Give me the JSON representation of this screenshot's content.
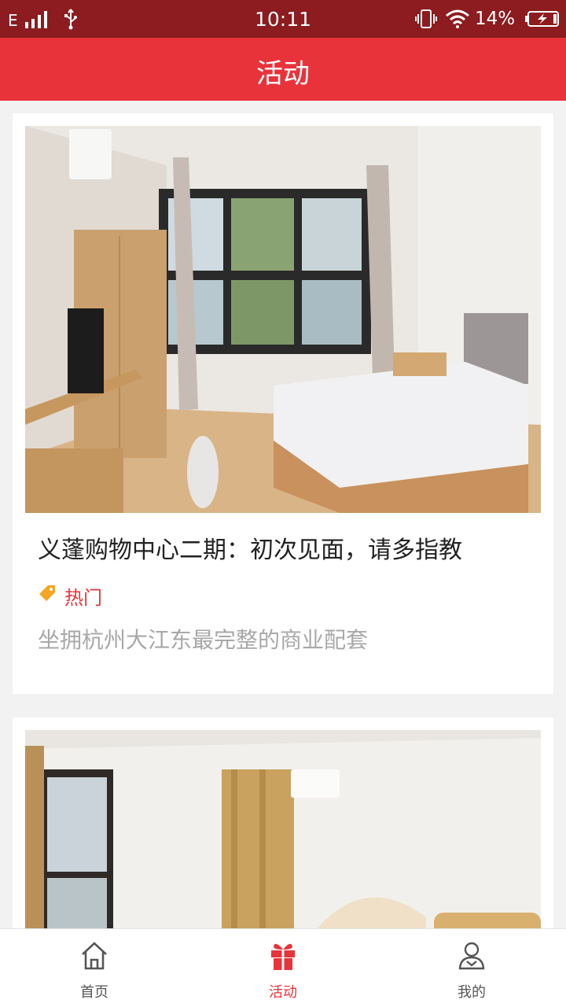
{
  "status_bar": {
    "network": "E",
    "time": "10:11",
    "battery_percent": "14%",
    "colors": {
      "background": "#8c1c1f"
    }
  },
  "header": {
    "title": "活动",
    "colors": {
      "background": "#e8333a"
    }
  },
  "activities": [
    {
      "title": "义蓬购物中心二期：初次见面，请多指教",
      "tag": "热门",
      "description": "坐拥杭州大江东最完整的商业配套",
      "image": "bedroom-photo-with-window"
    },
    {
      "image": "bedroom-photo-with-curtains"
    }
  ],
  "bottom_nav": {
    "items": [
      {
        "label": "首页",
        "icon": "home-icon",
        "active": false
      },
      {
        "label": "活动",
        "icon": "gift-icon",
        "active": true
      },
      {
        "label": "我的",
        "icon": "user-icon",
        "active": false
      }
    ],
    "colors": {
      "active": "#e8333a",
      "inactive": "#555555"
    }
  }
}
